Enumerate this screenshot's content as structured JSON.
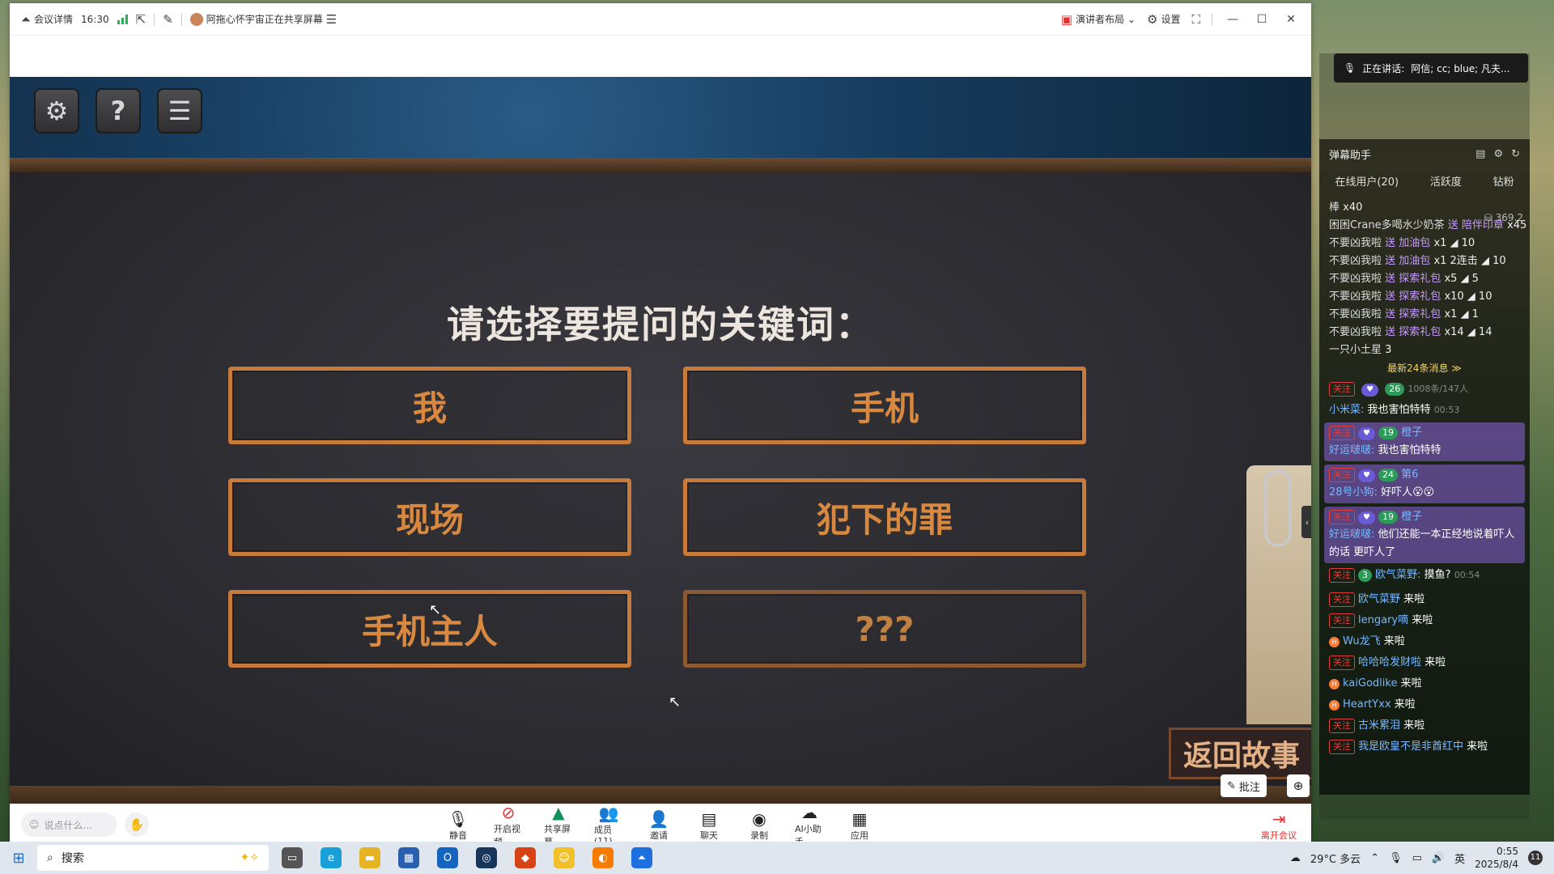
{
  "titlebar": {
    "meeting_info": "会议详情",
    "time": "16:30",
    "sharer": "阿拖心怀宇宙正在共享屏幕",
    "layout": "演讲者布局",
    "settings": "设置"
  },
  "game": {
    "question": "请选择要提问的关键词：",
    "keywords": [
      "我",
      "手机",
      "现场",
      "犯下的罪",
      "手机主人",
      "???"
    ],
    "back_story": "返回故事"
  },
  "share_controls": {
    "annotate": "批注"
  },
  "toolbar": {
    "chat_placeholder": "说点什么...",
    "mute": "静音",
    "video": "开启视频",
    "share": "共享屏幕",
    "members": "成员(11)",
    "invite": "邀请",
    "chat": "聊天",
    "record": "录制",
    "ai": "AI小助手",
    "apps": "应用",
    "leave": "离开会议"
  },
  "speaking": {
    "label": "正在讲话:",
    "names": "阿信; cc; blue; 凡夫..."
  },
  "danmu": {
    "title": "弹幕助手",
    "tabs": [
      "在线用户(20)",
      "活跃度",
      "钻粉"
    ],
    "total": "369.2",
    "gifts": [
      {
        "user": "棒",
        "gift": "",
        "detail": "x40"
      },
      {
        "user": "困困Crane多喝水少奶茶",
        "gift": "送 陪伴印章",
        "detail": "x45"
      },
      {
        "user": "不要凶我啦",
        "gift": "送 加油包",
        "detail": "x1 ◢ 10"
      },
      {
        "user": "不要凶我啦",
        "gift": "送 加油包",
        "detail": "x1 2连击 ◢ 10"
      },
      {
        "user": "不要凶我啦",
        "gift": "送 探索礼包",
        "detail": "x5 ◢ 5"
      },
      {
        "user": "不要凶我啦",
        "gift": "送 探索礼包",
        "detail": "x10 ◢ 10"
      },
      {
        "user": "不要凶我啦",
        "gift": "送 探索礼包",
        "detail": "x1 ◢ 1"
      },
      {
        "user": "不要凶我啦",
        "gift": "送 探索礼包",
        "detail": "x14 ◢ 14"
      },
      {
        "user": "一只小土星",
        "gift": "",
        "detail": "3"
      }
    ],
    "new_msg": "最新24条消息 ≫",
    "follow": "关注",
    "fans_stat": "1008条/147人",
    "level_main": "26",
    "chat": [
      {
        "user": "小米菜:",
        "msg": "我也害怕特特",
        "time": "00:53"
      },
      {
        "user": "好运啵啵:",
        "msg": "我也害怕特特",
        "level": "19",
        "extra": "橙子",
        "highlight": true
      },
      {
        "user": "28号小狗:",
        "msg": "好吓人😮😮",
        "level": "24",
        "extra": "第6",
        "highlight": true
      },
      {
        "user": "好运啵啵:",
        "msg": "他们还能一本正经地说着吓人的话 更吓人了",
        "level": "19",
        "extra": "橙子",
        "highlight": true
      },
      {
        "user": "欧气菜野:",
        "msg": "摸鱼?",
        "level": "3",
        "time": "00:54"
      }
    ],
    "welcome": [
      {
        "user": "欧气菜野",
        "msg": "来啦",
        "badge": "follow"
      },
      {
        "user": "lengary嘀",
        "msg": "来啦",
        "badge": "follow"
      },
      {
        "user": "Wu龙飞",
        "msg": "来啦",
        "badge": "dot"
      },
      {
        "user": "哈哈哈发财啦",
        "msg": "来啦",
        "badge": "follow"
      },
      {
        "user": "kaiGodlike",
        "msg": "来啦",
        "badge": "dot"
      },
      {
        "user": "HeartYxx",
        "msg": "来啦",
        "badge": "dot"
      },
      {
        "user": "古米累泪",
        "msg": "来啦",
        "badge": "follow"
      },
      {
        "user": "我是欧皇不是非酋红中",
        "msg": "来啦",
        "badge": "follow"
      }
    ]
  },
  "taskbar": {
    "search": "搜索",
    "weather": "29°C 多云",
    "ime": "英",
    "time": "0:55",
    "date": "2025/8/4",
    "notif": "11"
  },
  "colors": {
    "accent_orange": "#c77a3a",
    "meeting_red": "#e03030",
    "taskbar_bg": "#dfe6ee"
  }
}
